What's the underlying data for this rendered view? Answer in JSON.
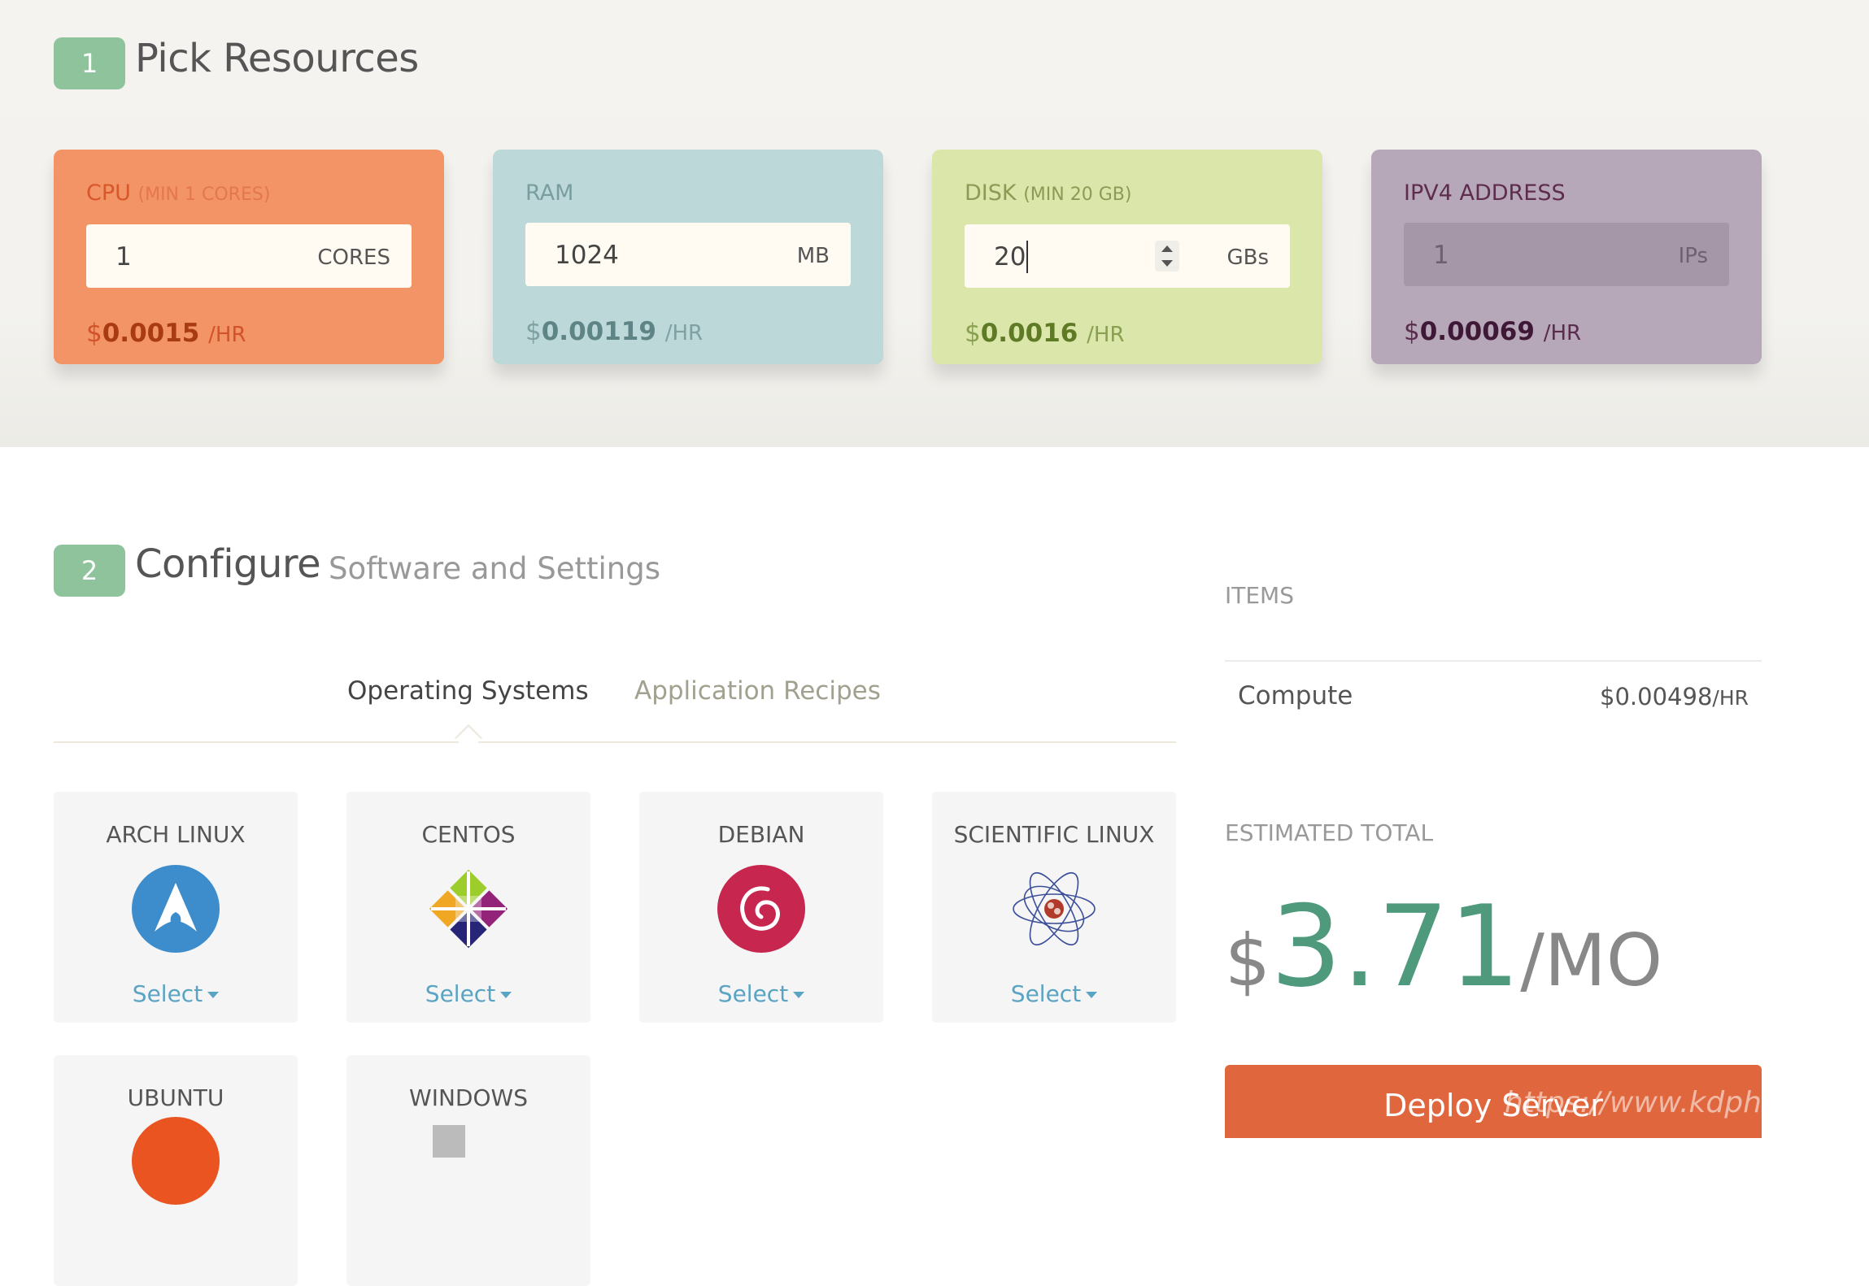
{
  "step1": {
    "number": "1",
    "title": "Pick Resources"
  },
  "resources": {
    "cpu": {
      "label": "CPU",
      "min": "(MIN 1 CORES)",
      "value": "1",
      "unit": "CORES",
      "currency": "$",
      "price": "0.0015",
      "per": "/HR",
      "color": "#f29466"
    },
    "ram": {
      "label": "RAM",
      "value": "1024",
      "unit": "MB",
      "currency": "$",
      "price": "0.00119",
      "per": "/HR",
      "color": "#bcd8d9"
    },
    "disk": {
      "label": "DISK",
      "min": "(MIN 20 GB)",
      "value": "20",
      "unit": "GBs",
      "currency": "$",
      "price": "0.0016",
      "per": "/HR",
      "color": "#dbe6aa"
    },
    "ipv4": {
      "label": "IPV4 ADDRESS",
      "value": "1",
      "unit": "IPs",
      "currency": "$",
      "price": "0.00069",
      "per": "/HR",
      "color": "#b7a8b9"
    }
  },
  "step2": {
    "number": "2",
    "title": "Configure",
    "subtitle": "Software and Settings"
  },
  "tabs": [
    {
      "label": "Operating Systems",
      "active": true
    },
    {
      "label": "Application Recipes",
      "active": false
    }
  ],
  "os_list": [
    {
      "name": "ARCH LINUX",
      "select": "Select",
      "icon": "arch-linux-logo"
    },
    {
      "name": "CENTOS",
      "select": "Select",
      "icon": "centos-logo"
    },
    {
      "name": "DEBIAN",
      "select": "Select",
      "icon": "debian-logo"
    },
    {
      "name": "SCIENTIFIC LINUX",
      "select": "Select",
      "icon": "scientific-linux-logo"
    },
    {
      "name": "UBUNTU",
      "icon": "ubuntu-logo"
    },
    {
      "name": "WINDOWS",
      "icon": "windows-logo"
    }
  ],
  "summary": {
    "items_heading": "ITEMS",
    "compute_label": "Compute",
    "compute_price": "$0.00498",
    "compute_per": "/HR",
    "total_heading": "ESTIMATED TOTAL",
    "total_currency": "$",
    "total_value": "3.71",
    "total_per": "/MO",
    "deploy_label": "Deploy Server"
  },
  "watermark": "https://www.kdph"
}
